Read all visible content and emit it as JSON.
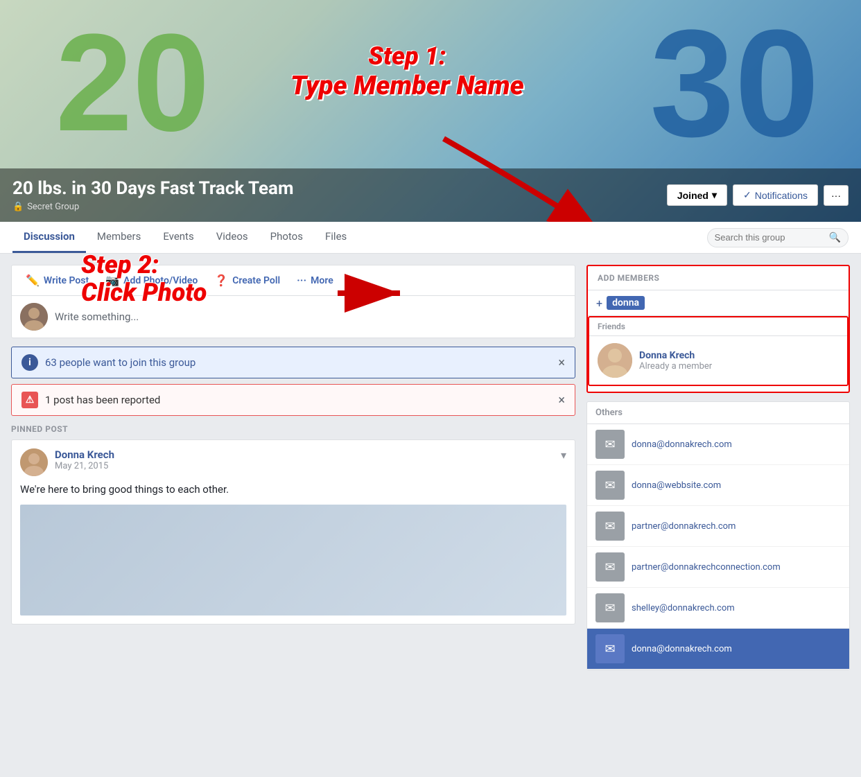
{
  "cover": {
    "group_name": "20 lbs. in 30 Days Fast Track Team",
    "group_type": "Secret Group",
    "logo_20": "20",
    "logo_30": "30"
  },
  "header_buttons": {
    "joined": "Joined",
    "notifications": "Notifications",
    "more": "···"
  },
  "step1": {
    "line1": "Step 1:",
    "line2": "Type Member Name"
  },
  "step2": {
    "line1": "Step 2:",
    "line2": "Click Photo"
  },
  "nav": {
    "tabs": [
      "Discussion",
      "Members",
      "Events",
      "Videos",
      "Photos",
      "Files"
    ],
    "active_tab": "Discussion",
    "search_placeholder": "Search this group"
  },
  "composer": {
    "write_post": "Write Post",
    "add_photo": "Add Photo/Video",
    "create_poll": "Create Poll",
    "more": "More",
    "placeholder": "Write something..."
  },
  "banners": {
    "info_text": "63 people want to join this group",
    "warning_text": "1 post has been reported"
  },
  "pinned": {
    "label": "PINNED POST",
    "author": "Donna Krech",
    "date": "May 21, 2015",
    "content": "We're here to bring good things to each other."
  },
  "add_members": {
    "header": "ADD MEMBERS",
    "input_prefix": "+",
    "input_value": "donna"
  },
  "friends": {
    "label": "Friends",
    "items": [
      {
        "name": "Donna Krech",
        "status": "Already a member"
      }
    ]
  },
  "others": {
    "label": "Others",
    "items": [
      "donna@donnakrech.com",
      "donna@webbsite.com",
      "partner@donnakrech.com",
      "partner@donnakrechconnection.com",
      "shelley@donnakrech.com",
      "donna@donnakrech.com"
    ]
  },
  "icons": {
    "lock": "🔒",
    "pencil": "✏️",
    "camera": "📷",
    "poll": "❓",
    "ellipsis": "···",
    "info": "i",
    "warning": "⚠",
    "check": "✓",
    "chevron_down": "▾",
    "chevron_right": "›",
    "search": "🔍",
    "mail": "✉",
    "close": "×"
  }
}
